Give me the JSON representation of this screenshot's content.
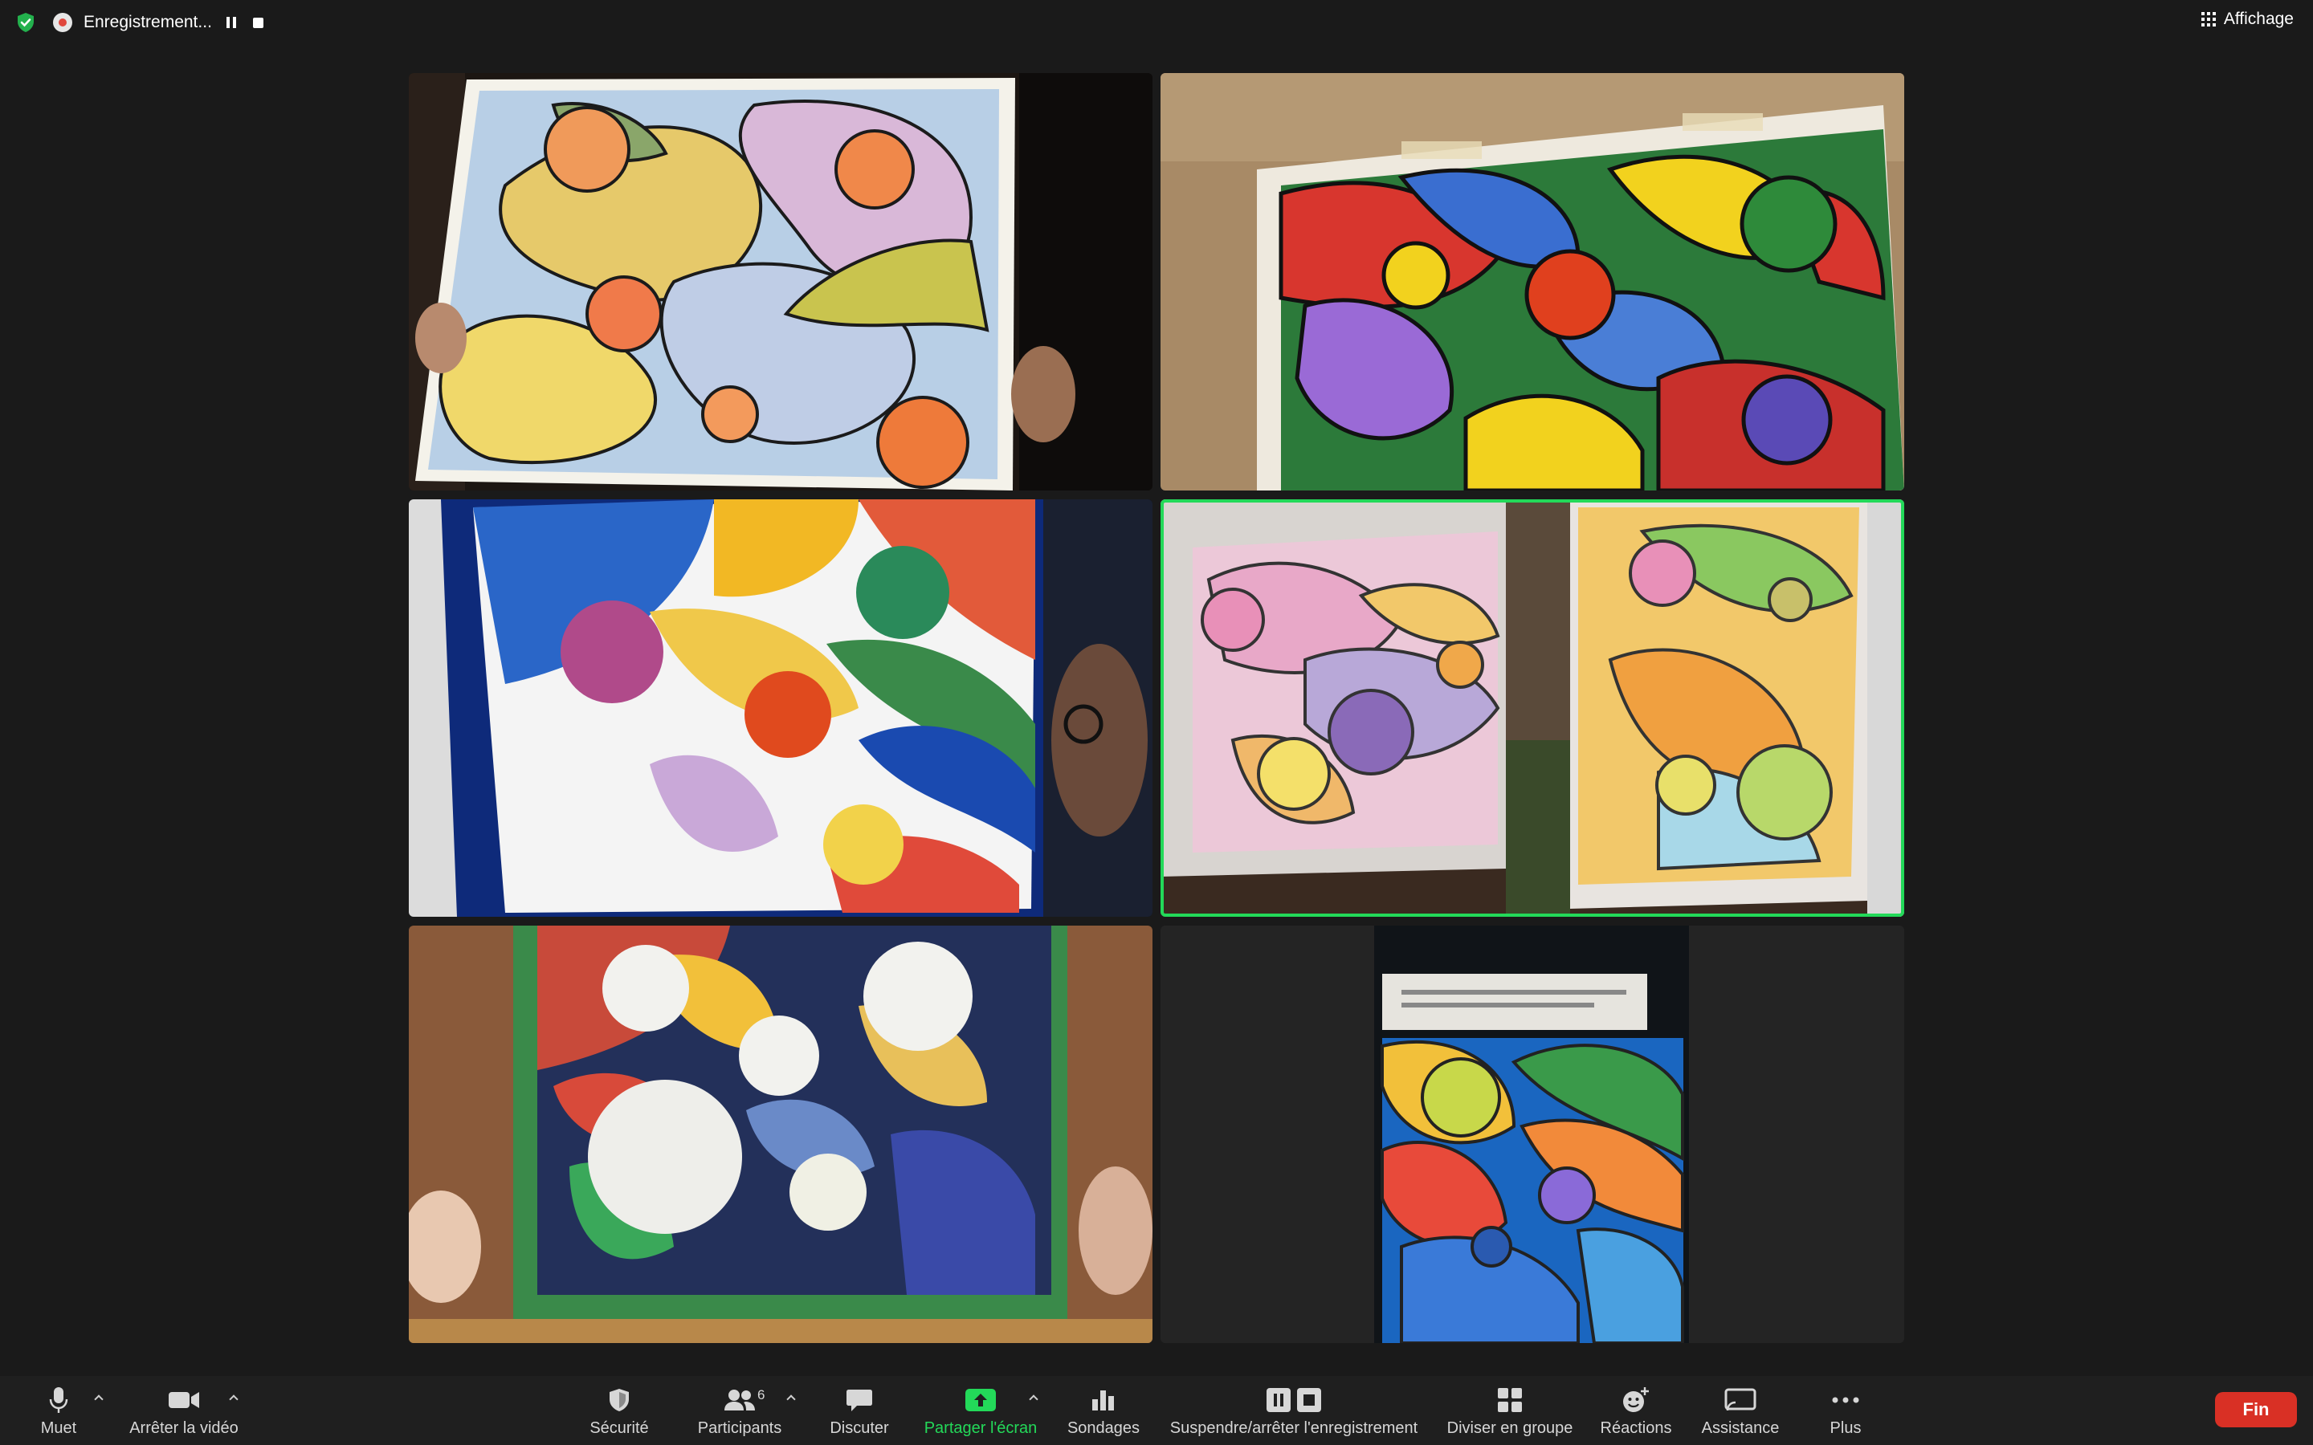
{
  "recording": {
    "status_text": "Enregistrement...",
    "indicator_color": "#e0473c"
  },
  "view_button": {
    "label": "Affichage"
  },
  "active_speaker_color": "#23d959",
  "toolbar": {
    "mute_label": "Muet",
    "video_label": "Arrêter la vidéo",
    "security_label": "Sécurité",
    "participants_label": "Participants",
    "participants_count": "6",
    "chat_label": "Discuter",
    "share_label": "Partager l'écran",
    "polls_label": "Sondages",
    "recording_label": "Suspendre/arrêter l'enregistrement",
    "breakout_label": "Diviser en groupe",
    "reactions_label": "Réactions",
    "assistance_label": "Assistance",
    "more_label": "Plus",
    "end_label": "Fin",
    "end_color": "#d93025"
  },
  "gallery": {
    "tiles": [
      {
        "content": "watercolor painting held up to camera"
      },
      {
        "content": "pastel painting on easel"
      },
      {
        "content": "painting held in front of participant"
      },
      {
        "content": "two paintings side by side",
        "active_speaker": true
      },
      {
        "content": "painting in brown frame"
      },
      {
        "content": "portrait video of painting"
      }
    ]
  }
}
